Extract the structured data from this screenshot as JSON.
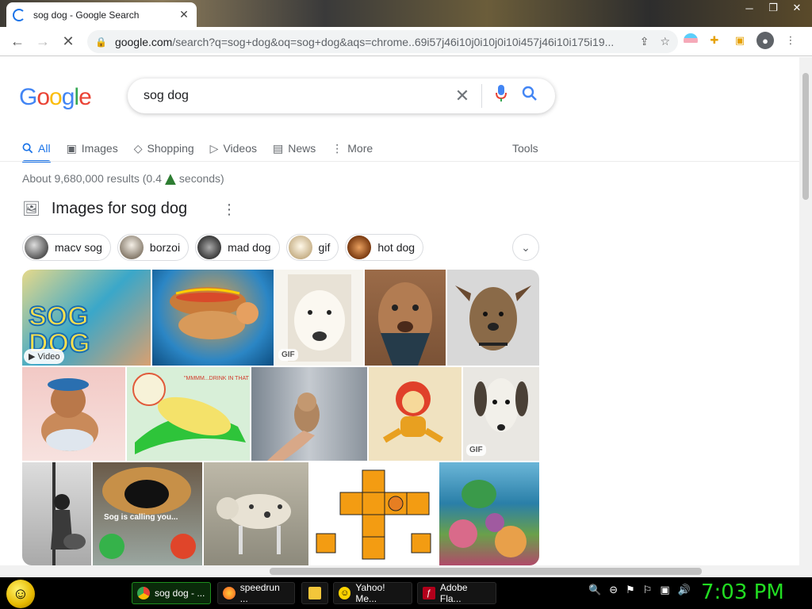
{
  "browser": {
    "tab_title": "sog dog - Google Search",
    "url_host": "google.com",
    "url_path": "/search?q=sog+dog&oq=sog+dog&aqs=chrome..69i57j46i10j0i10j0i10i457j46i10i175i19..."
  },
  "search": {
    "query": "sog dog",
    "logo": [
      "G",
      "o",
      "o",
      "g",
      "l",
      "e"
    ],
    "logo_colors": [
      "#4285F4",
      "#EA4335",
      "#FBBC05",
      "#4285F4",
      "#34A853",
      "#EA4335"
    ]
  },
  "tabs": [
    {
      "label": "All",
      "icon": "search-icon"
    },
    {
      "label": "Images",
      "icon": "image-icon"
    },
    {
      "label": "Shopping",
      "icon": "tag-icon"
    },
    {
      "label": "Videos",
      "icon": "video-icon"
    },
    {
      "label": "News",
      "icon": "news-icon"
    },
    {
      "label": "More",
      "icon": "more-vert-icon"
    }
  ],
  "tools_label": "Tools",
  "results_stats": "About 9,680,000 results (0.4",
  "results_stats_tail": "seconds)",
  "images_section_title": "Images for sog dog",
  "chips": [
    {
      "label": "macv sog",
      "color": "#6b6b6b"
    },
    {
      "label": "borzoi",
      "color": "#c9bfb0"
    },
    {
      "label": "mad dog",
      "color": "#8a8a8a"
    },
    {
      "label": "gif",
      "color": "#e8d9b8"
    },
    {
      "label": "hot dog",
      "color": "#b5651d"
    }
  ],
  "badges": {
    "video": "Video",
    "gif": "GIF",
    "caption": "Sog is calling you..."
  },
  "taskbar": {
    "items": [
      {
        "label": "sog dog - ...",
        "icon": "chrome-icon",
        "active": true
      },
      {
        "label": "speedrun ...",
        "icon": "firefox-icon",
        "active": false
      },
      {
        "label": "",
        "icon": "folder-icon",
        "active": false
      },
      {
        "label": "Yahoo! Me...",
        "icon": "yahoo-messenger-icon",
        "active": false
      },
      {
        "label": "Adobe Fla...",
        "icon": "adobe-flash-icon",
        "active": false
      }
    ],
    "clock": "7:03 PM"
  }
}
